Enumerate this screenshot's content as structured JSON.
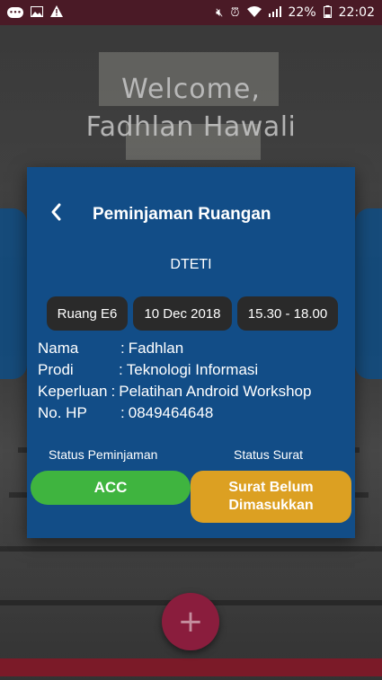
{
  "status_bar": {
    "battery": "22%",
    "time": "22:02",
    "left_icons": [
      "messenger-icon",
      "image-icon",
      "warning-icon"
    ],
    "right_icons": [
      "mute-icon",
      "alarm-icon",
      "wifi-icon",
      "signal-icon",
      "battery-icon"
    ]
  },
  "welcome": {
    "line1": "Welcome,",
    "line2": "Fadhlan Hawali"
  },
  "dialog": {
    "title": "Peminjaman Ruangan",
    "department": "DTETI",
    "chips": {
      "room": "Ruang E6",
      "date": "10 Dec 2018",
      "time": "15.30 - 18.00"
    },
    "info": [
      {
        "label": "Nama",
        "value": "Fadhlan"
      },
      {
        "label": "Prodi",
        "value": "Teknologi Informasi"
      },
      {
        "label": "Keperluan",
        "value": "Pelatihan Android Workshop"
      },
      {
        "label": "No. HP",
        "value": "0849464648"
      }
    ],
    "status_peminjaman_label": "Status Peminjaman",
    "status_surat_label": "Status Surat",
    "status_peminjaman_value": "ACC",
    "status_surat_value": "Surat Belum Dimasukkan"
  },
  "fab": {
    "label": "+"
  },
  "colors": {
    "dialog_bg": "#124d87",
    "acc_green": "#3fb43f",
    "surat_orange": "#dca022",
    "status_bar": "#4a1a26",
    "fab": "#8a1d3d"
  }
}
